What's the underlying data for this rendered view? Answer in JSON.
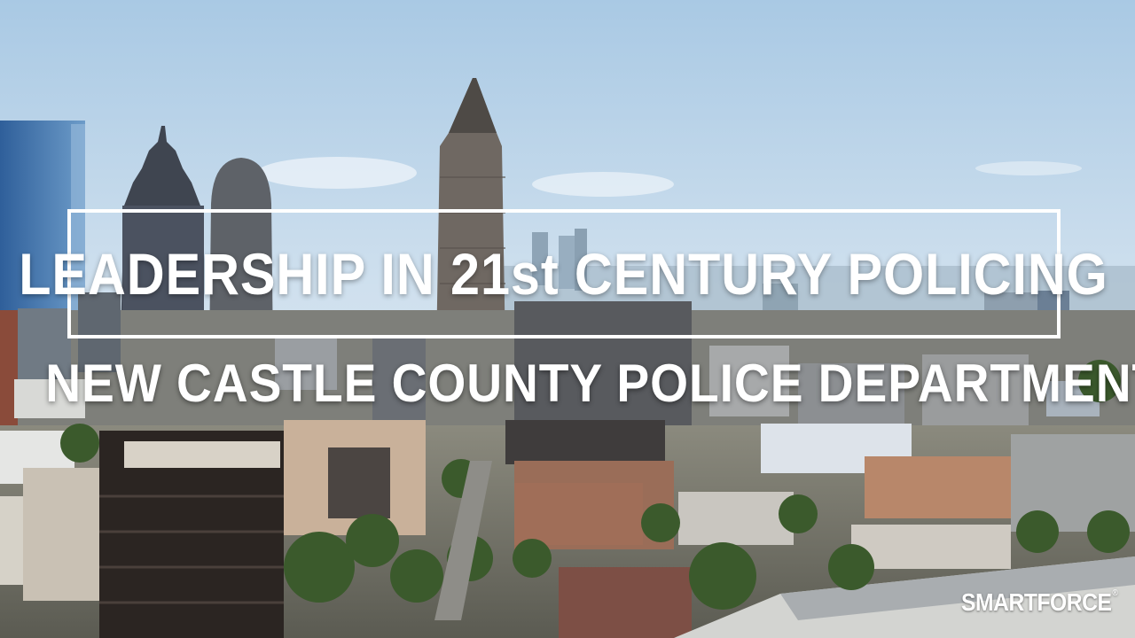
{
  "overlay": {
    "title": "LEADERSHIP IN 21st CENTURY POLICING",
    "subtitle": "NEW CASTLE COUNTY POLICE DEPARTMENT"
  },
  "brand": {
    "name": "SMARTFORCE",
    "mark": "®"
  },
  "colors": {
    "sky": "#b9d2e6",
    "overlay_text": "#ffffff"
  }
}
